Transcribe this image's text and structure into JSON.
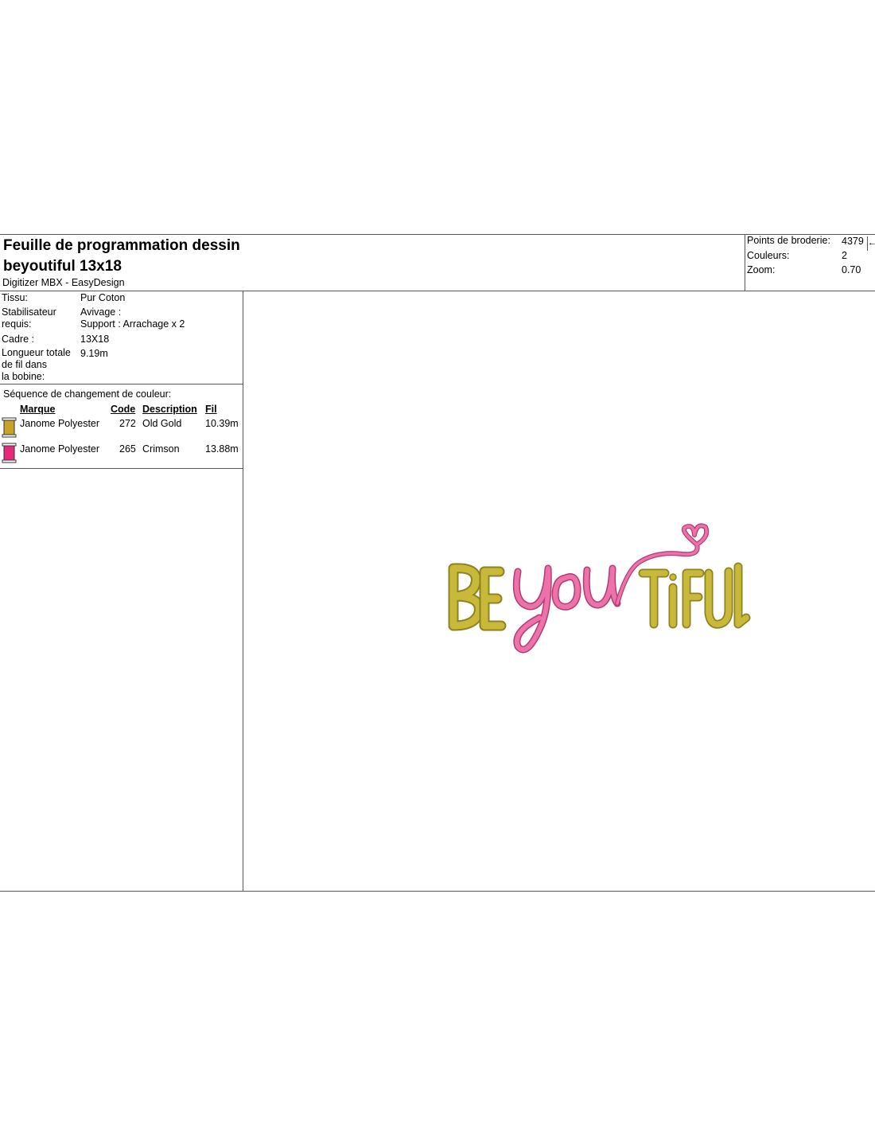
{
  "header": {
    "title_line1": "Feuille de programmation dessin",
    "title_line2": "beyoutiful 13x18",
    "subtitle": "Digitizer MBX - EasyDesign"
  },
  "stats": {
    "stitches_label": "Points de broderie:",
    "stitches_value": "4379",
    "colors_label": "Couleurs:",
    "colors_value": "2",
    "zoom_label": "Zoom:",
    "zoom_value": "0.70",
    "arrow": "←"
  },
  "properties": {
    "fabric_label": "Tissu:",
    "fabric_value": "Pur Coton",
    "stabilizer_label_1": "Stabilisateur",
    "stabilizer_label_2": "requis:",
    "stabilizer_value_1": "Avivage :",
    "stabilizer_value_2": "Support : Arrachage x 2",
    "frame_label": "Cadre :",
    "frame_value": "13X18",
    "thread_label_1": "Longueur totale",
    "thread_label_2": "de fil dans",
    "thread_label_3": "la bobine:",
    "thread_value": "9.19m"
  },
  "sequence": {
    "title": "Séquence de changement de couleur:",
    "columns": {
      "brand": "Marque",
      "code": "Code",
      "description": "Description",
      "thread": "Fil"
    },
    "rows": [
      {
        "brand": "Janome Polyester",
        "code": "272",
        "description": "Old Gold",
        "thread": "10.39m",
        "color": "#c9a227"
      },
      {
        "brand": "Janome Polyester",
        "code": "265",
        "description": "Crimson",
        "thread": "13.88m",
        "color": "#e8287a"
      }
    ]
  },
  "design": {
    "gold_color": "#c9b93a",
    "gold_dark": "#8f8220",
    "pink_color": "#ec72a8",
    "pink_dark": "#b23c74"
  }
}
